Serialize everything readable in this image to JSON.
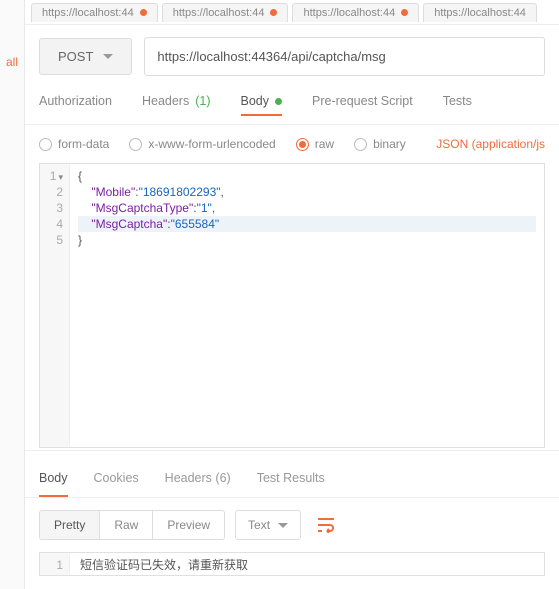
{
  "sidebar": {
    "all": "all"
  },
  "tabs": [
    {
      "label": "https://localhost:44"
    },
    {
      "label": "https://localhost:44"
    },
    {
      "label": "https://localhost:44"
    },
    {
      "label": "https://localhost:44"
    }
  ],
  "request": {
    "method": "POST",
    "url": "https://localhost:44364/api/captcha/msg"
  },
  "reqTabs": {
    "authorization": "Authorization",
    "headers": "Headers",
    "headersCount": "(1)",
    "body": "Body",
    "prerequest": "Pre-request Script",
    "tests": "Tests"
  },
  "bodyOptions": {
    "formdata": "form-data",
    "urlencoded": "x-www-form-urlencoded",
    "raw": "raw",
    "binary": "binary",
    "jsonType": "JSON (application/js"
  },
  "editor": {
    "lines": [
      "1",
      "2",
      "3",
      "4",
      "5"
    ],
    "json": {
      "Mobile": "18691802293",
      "MsgCaptchaType": "1",
      "MsgCaptcha": "655584"
    }
  },
  "respTabs": {
    "body": "Body",
    "cookies": "Cookies",
    "headers": "Headers",
    "headersCount": "(6)",
    "tests": "Test Results"
  },
  "respTools": {
    "pretty": "Pretty",
    "raw": "Raw",
    "preview": "Preview",
    "textDropdown": "Text"
  },
  "response": {
    "line1": "1",
    "text": "短信验证码已失效，请重新获取"
  }
}
